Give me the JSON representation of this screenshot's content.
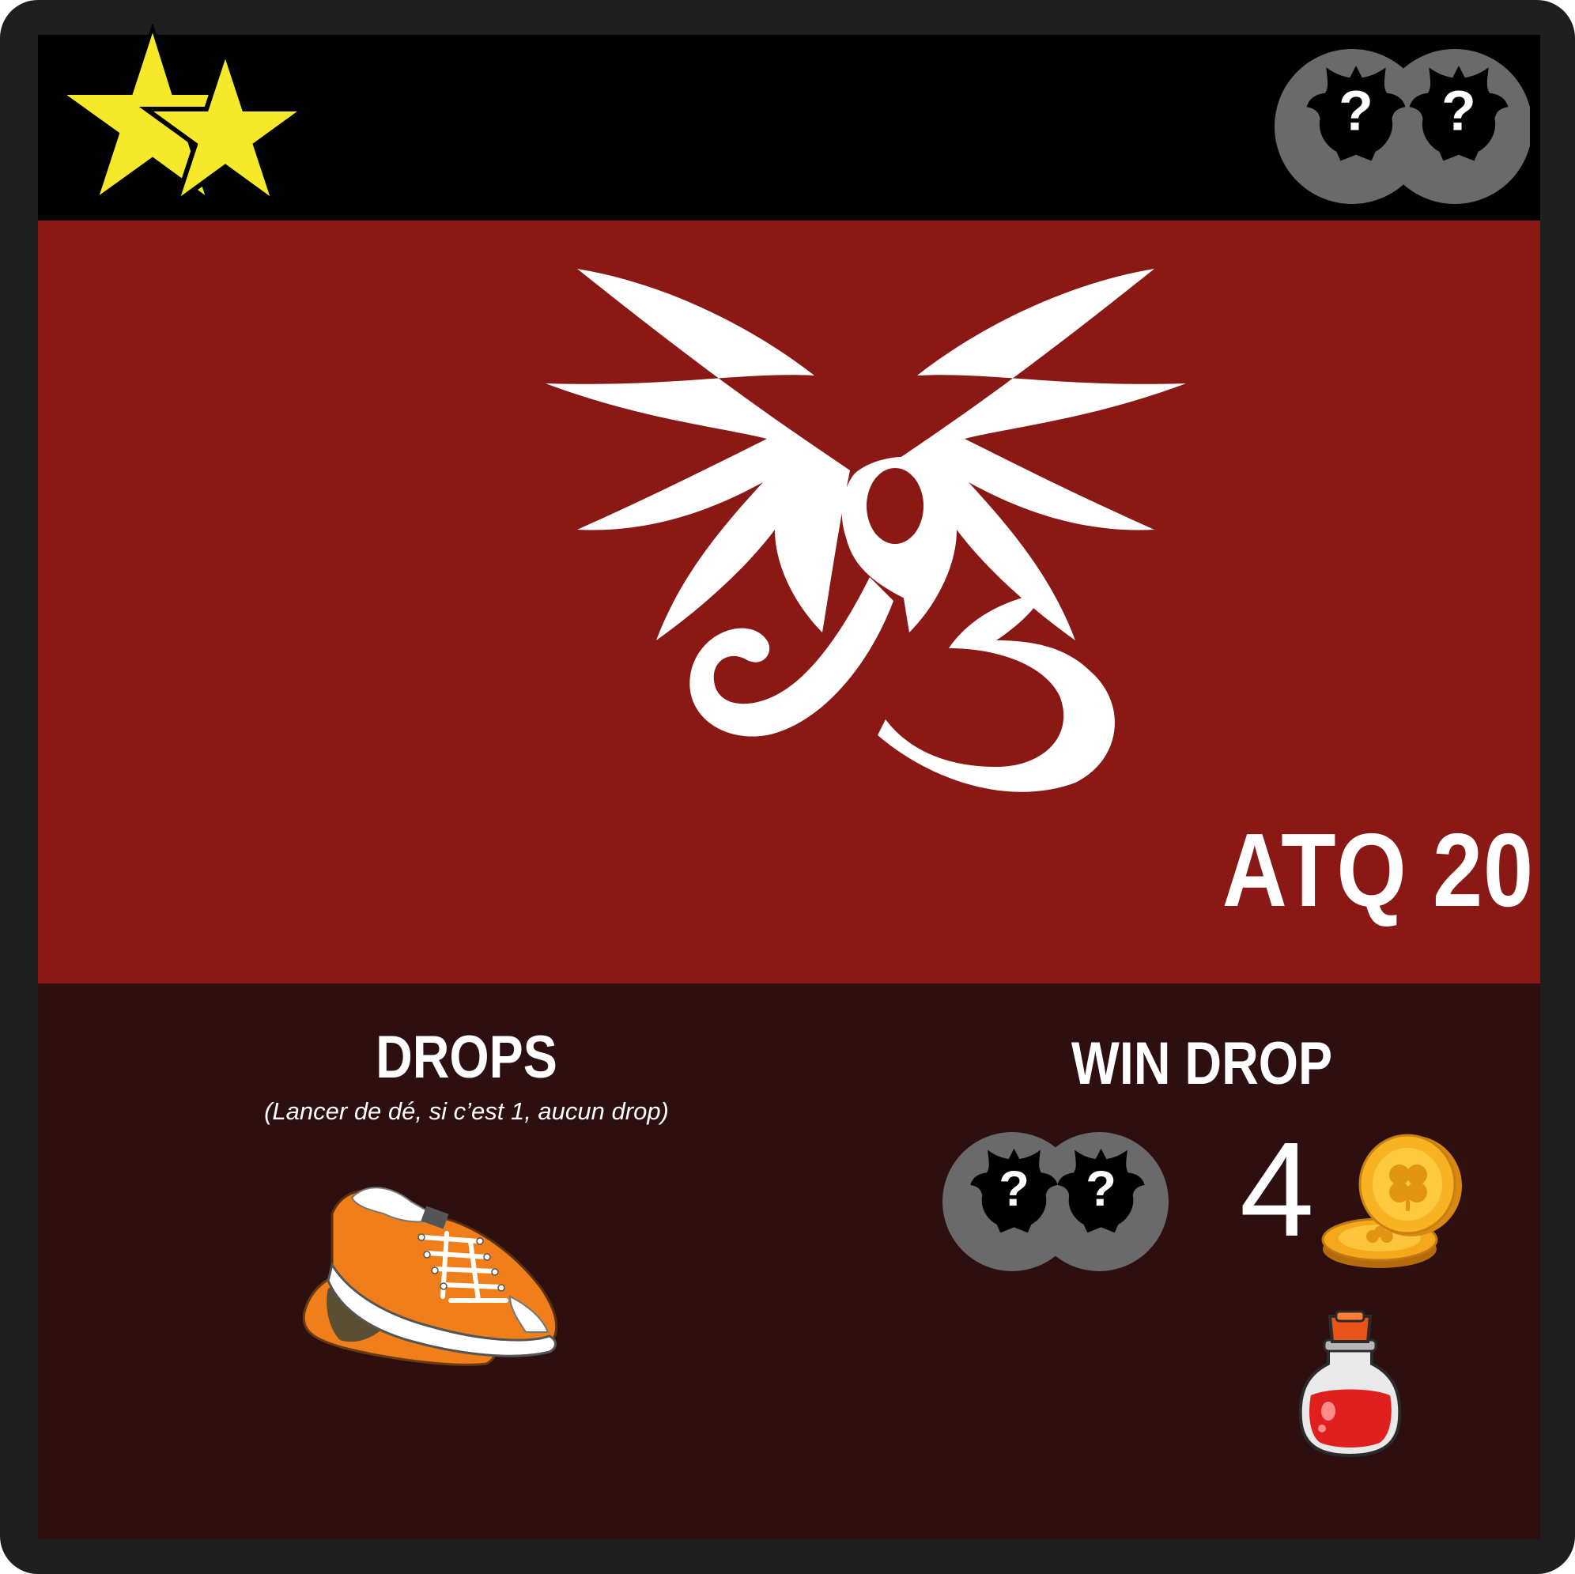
{
  "card": {
    "rarity_stars": 2,
    "enemy_badges": [
      {
        "symbol": "?",
        "icon": "mystery-creature-icon"
      },
      {
        "symbol": "?",
        "icon": "mystery-creature-icon"
      }
    ],
    "emblem_icon": "winged-tribal-emblem-icon",
    "attack_label": "ATQ 20",
    "colors": {
      "frame": "#1e1e1e",
      "header": "#000000",
      "art_background": "#8a1814",
      "lower_background": "#2e0f10",
      "star": "#f5e92a",
      "badge": "#6a6a6a",
      "text": "#ffffff"
    }
  },
  "drops": {
    "title": "DROPS",
    "subtitle": "(Lancer de dé, si c’est 1, aucun drop)",
    "items": [
      {
        "icon": "orange-sneaker-icon"
      }
    ]
  },
  "win_drop": {
    "title": "WIN DROP",
    "badges": [
      {
        "symbol": "?",
        "icon": "mystery-creature-icon"
      },
      {
        "symbol": "?",
        "icon": "mystery-creature-icon"
      }
    ],
    "coin_count": "4",
    "coin_icon": "gold-clover-coin-icon",
    "extra_item_icon": "red-potion-icon"
  }
}
